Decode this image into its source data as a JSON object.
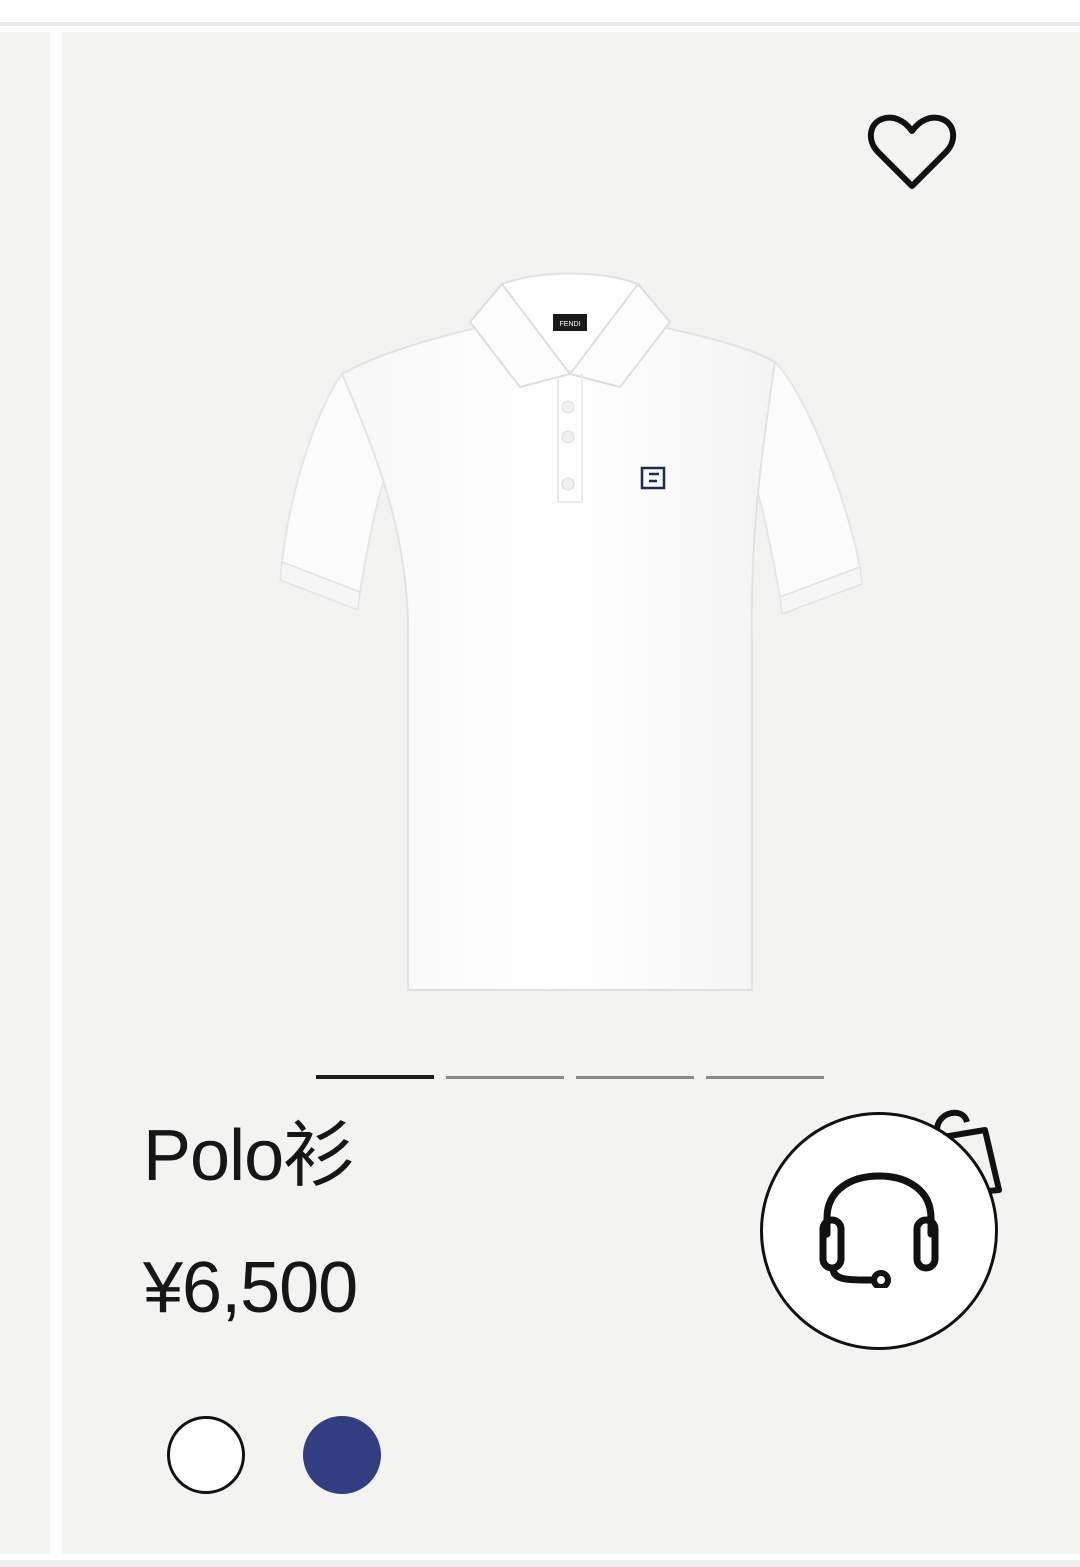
{
  "product": {
    "name": "Polo衫",
    "price": "¥6,500",
    "image": {
      "alt": "white polo shirt",
      "neck_label": "FENDI"
    },
    "image_pager": {
      "count": 4,
      "active_index": 0
    },
    "colors": [
      {
        "name": "white",
        "hex": "#ffffff"
      },
      {
        "name": "navy",
        "hex": "#323d82"
      }
    ]
  },
  "icons": {
    "wishlist": "heart-icon",
    "support": "headset-icon",
    "bag": "shopping-bag-icon"
  },
  "theme": {
    "card_bg": "#f3f3f2",
    "text": "#161616"
  }
}
